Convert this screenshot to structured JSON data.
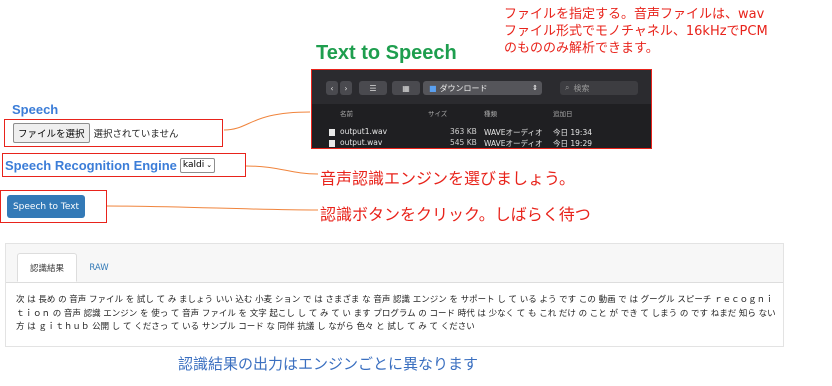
{
  "title": "Text to Speech",
  "annotations": {
    "top_note": [
      "ファイルを指定する。音声ファイルは、wav",
      "ファイル形式でモノチャネル、16kHzでPCM",
      "のもののみ解析できます。"
    ],
    "engine_note": "音声認識エンジンを選びましょう。",
    "button_note": "認識ボタンをクリック。しばらく待つ",
    "result_note": "認識結果の出力はエンジンごとに異なります"
  },
  "speech": {
    "label": "Speech",
    "file_button": "ファイルを選択",
    "file_status": "選択されていません"
  },
  "engine": {
    "label": "Speech Recognition Engine",
    "selected": "kaldi"
  },
  "action_button": "Speech to Text",
  "file_dialog": {
    "location": "ダウンロード",
    "search_placeholder": "検索",
    "columns": [
      "名前",
      "サイズ",
      "種類",
      "追加日"
    ],
    "files": [
      {
        "name": "output1.wav",
        "size": "363 KB",
        "kind": "WAVEオーディオ",
        "added": "今日 19:34"
      },
      {
        "name": "output.wav",
        "size": "545 KB",
        "kind": "WAVEオーディオ",
        "added": "今日 19:29"
      }
    ]
  },
  "result_panel": {
    "tabs": [
      "認識結果",
      "RAW"
    ],
    "text": "次 は 長め の 音声 ファイル を 試し て み ましょう いい 込む 小麦 ション で は さまざま な 音声 認識 エンジン を サポート し て いる よう です この 動画 で は グーグル スピーチ ｒｅｃｏｇｎｉｔｉｏｎ の 音声 認識 エンジン を 使っ て 音声 ファイル を 文字 起こし し て み て い ます プログラム の コード 時代 は 少なく て も これ だけ の こと が でき て しまう の です ねまだ 知ら ない 方 は ｇｉｔｈｕｂ 公開 し て くださっ て いる サンプル コード な 同伴 抗議 し ながら 色々 と 試し て み て ください"
  },
  "colors": {
    "annotation_red": "#e8231b",
    "title_green": "#1e9e4e",
    "label_blue": "#3b7dd8",
    "button_blue": "#337ab7",
    "note_blue": "#3a6fc0"
  }
}
